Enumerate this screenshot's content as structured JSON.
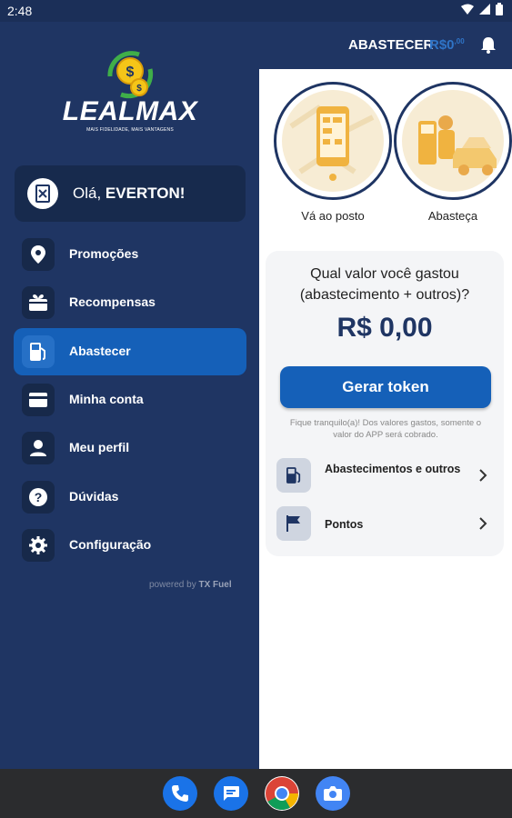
{
  "status_bar": {
    "time": "2:48"
  },
  "app_bar": {
    "title": "ABASTECER",
    "balance": "R$0",
    "balance_cents": ",00"
  },
  "drawer": {
    "brand": "LEALMAX",
    "tagline": "MAIS FIDELIDADE, MAIS VANTAGENS",
    "greeting_prefix": "Olá,",
    "user_name": "EVERTON!",
    "items": [
      {
        "label": "Promoções",
        "icon": "location-pin-icon"
      },
      {
        "label": "Recompensas",
        "icon": "gift-icon"
      },
      {
        "label": "Abastecer",
        "icon": "fuel-pump-icon",
        "active": true
      },
      {
        "label": "Minha conta",
        "icon": "wallet-icon"
      },
      {
        "label": "Meu perfil",
        "icon": "person-icon"
      },
      {
        "label": "Dúvidas",
        "icon": "help-icon"
      },
      {
        "label": "Configuração",
        "icon": "gear-icon"
      }
    ],
    "powered_prefix": "powered by",
    "powered_brand": "TX Fuel"
  },
  "content": {
    "steps": [
      {
        "label": "Vá ao posto",
        "icon": "phone-map-illustration"
      },
      {
        "label": "Abasteça",
        "icon": "attendant-car-illustration"
      }
    ],
    "question": "Qual valor você gastou (abastecimento + outros)?",
    "amount": "R$ 0,00",
    "token_button": "Gerar token",
    "note": "Fique tranquilo(a)! Dos valores gastos, somente o valor do APP será cobrado.",
    "rows": [
      {
        "label": "Abastecimentos e outros",
        "icon": "fuel-pump-icon"
      },
      {
        "label": "Pontos",
        "icon": "flag-icon"
      }
    ]
  },
  "colors": {
    "primary": "#1f3563",
    "accent": "#1560b8",
    "illustration": "#f0b340"
  },
  "dock": [
    "phone-icon",
    "messages-icon",
    "chrome-icon",
    "camera-icon"
  ]
}
